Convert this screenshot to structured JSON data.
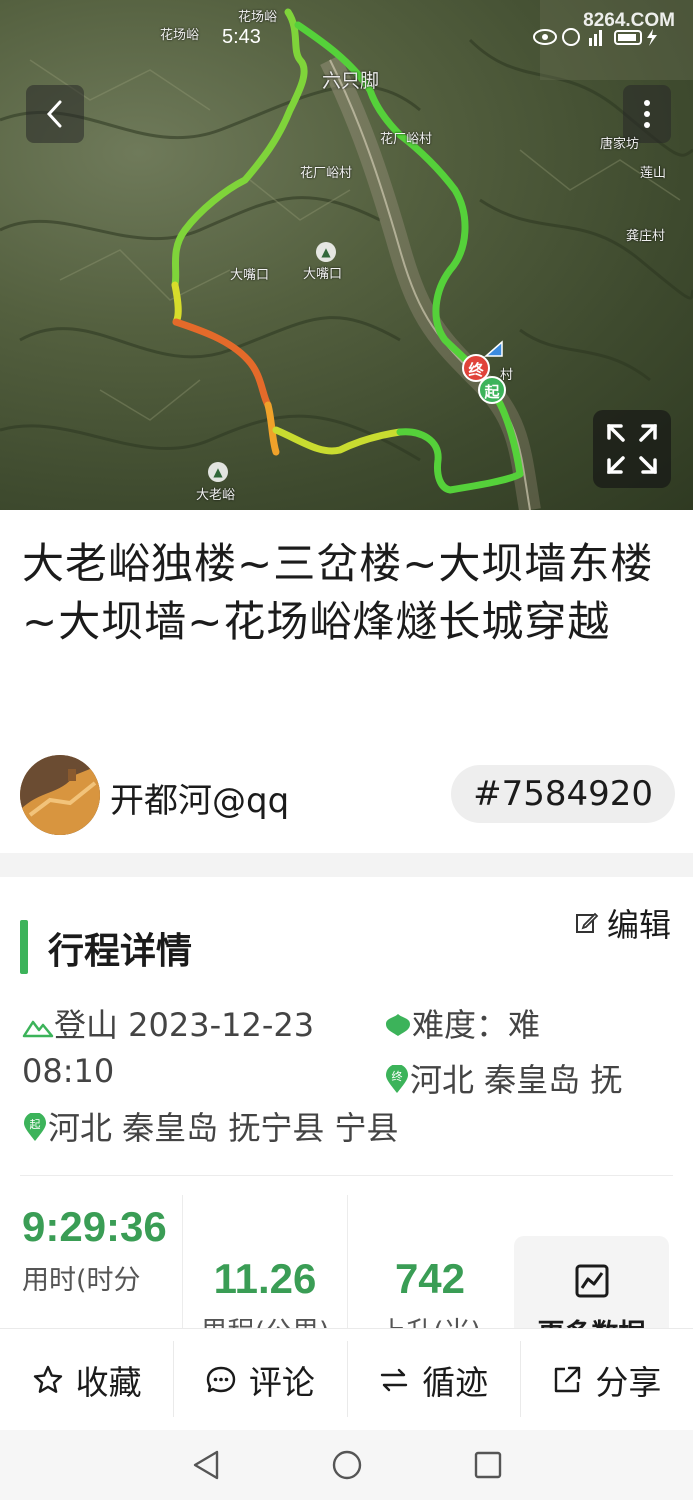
{
  "status_bar": {
    "time": "5:43",
    "watermark": "8264.COM"
  },
  "map": {
    "places": {
      "p1": "花场峪",
      "p2": "花场峪",
      "p3": "六只脚",
      "p4": "花厂峪村",
      "p5": "花厂峪村",
      "p6": "唐家坊",
      "p7": "莲山",
      "p8": "大嘴口",
      "p9": "大嘴口",
      "p10": "龚庄村",
      "p11": "大老峪",
      "p12": "村"
    },
    "start_label": "起",
    "end_label": "终",
    "route_colors": {
      "green": "#55d13a",
      "yellow": "#d7dd2b",
      "orange": "#f08a2a",
      "red": "#e25a2a"
    }
  },
  "title": "大老峪独楼~三岔楼~大坝墙东楼~大坝墙~花场峪烽燧长城穿越",
  "author": {
    "name": "开都河@qq",
    "track_id": "#7584920"
  },
  "detail": {
    "section_title": "行程详情",
    "edit_label": "编辑",
    "activity": "登山 2023-12-23 08:10",
    "difficulty": "难度：难",
    "end_location": "河北 秦皇岛 抚",
    "start_location": "河北 秦皇岛 抚宁县 宁县"
  },
  "stats": [
    {
      "value": "9:29:36",
      "label": "用时(时分"
    },
    {
      "value": "11.26",
      "label": "里程(公里)"
    },
    {
      "value": "742",
      "label": "上升(米)"
    }
  ],
  "more_data_label": "更多数据",
  "bottom_bar": {
    "favorite": "收藏",
    "comment": "评论",
    "follow_track": "循迹",
    "share": "分享"
  },
  "accent_color": "#3cb35a"
}
